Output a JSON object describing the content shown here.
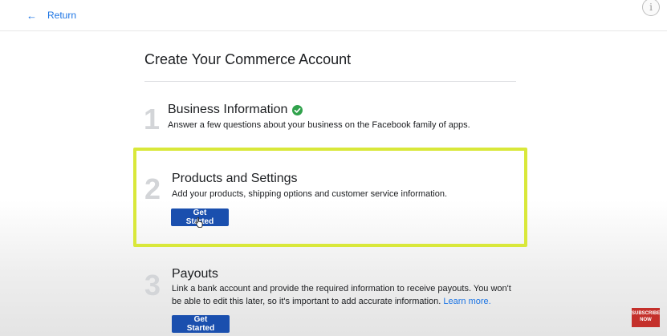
{
  "header": {
    "return_label": "Return",
    "return_icon": "←",
    "info_icon": "i"
  },
  "page": {
    "title": "Create Your Commerce Account"
  },
  "steps": [
    {
      "number": "1",
      "title": "Business Information",
      "description": "Answer a few questions about your business on the Facebook family of apps.",
      "status": "complete",
      "status_color": "#31a24c"
    },
    {
      "number": "2",
      "title": "Products and Settings",
      "description": "Add your products, shipping options and customer service information.",
      "button_label": "Get Started"
    },
    {
      "number": "3",
      "title": "Payouts",
      "description": "Link a bank account and provide the required information to receive payouts. You won't be able to edit this later, so it's important to add accurate information.",
      "link_label": "Learn more.",
      "button_label": "Get Started"
    }
  ],
  "overlay": {
    "subscribe_line1": "SUBSCRIBE",
    "subscribe_line2": "NOW",
    "highlight_color": "#d9e83a"
  },
  "colors": {
    "link": "#1b74e4",
    "button": "#1a4fae",
    "step_number": "#d3d5d8"
  }
}
